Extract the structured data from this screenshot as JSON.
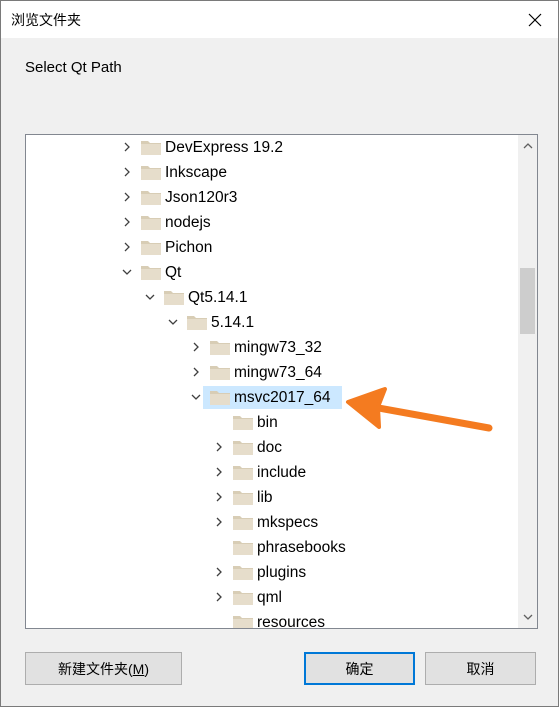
{
  "window": {
    "title": "浏览文件夹",
    "close_icon": "close-icon"
  },
  "prompt": "Select Qt Path",
  "tree": {
    "nodes": [
      {
        "label": "DevExpress 19.2",
        "depth": 0,
        "state": "collapsed"
      },
      {
        "label": "Inkscape",
        "depth": 0,
        "state": "collapsed"
      },
      {
        "label": "Json120r3",
        "depth": 0,
        "state": "collapsed"
      },
      {
        "label": "nodejs",
        "depth": 0,
        "state": "collapsed"
      },
      {
        "label": "Pichon",
        "depth": 0,
        "state": "collapsed"
      },
      {
        "label": "Qt",
        "depth": 0,
        "state": "expanded"
      },
      {
        "label": "Qt5.14.1",
        "depth": 1,
        "state": "expanded"
      },
      {
        "label": "5.14.1",
        "depth": 2,
        "state": "expanded"
      },
      {
        "label": "mingw73_32",
        "depth": 3,
        "state": "collapsed"
      },
      {
        "label": "mingw73_64",
        "depth": 3,
        "state": "collapsed"
      },
      {
        "label": "msvc2017_64",
        "depth": 3,
        "state": "expanded",
        "selected": true
      },
      {
        "label": "bin",
        "depth": 4,
        "state": "none"
      },
      {
        "label": "doc",
        "depth": 4,
        "state": "collapsed"
      },
      {
        "label": "include",
        "depth": 4,
        "state": "collapsed"
      },
      {
        "label": "lib",
        "depth": 4,
        "state": "collapsed"
      },
      {
        "label": "mkspecs",
        "depth": 4,
        "state": "collapsed"
      },
      {
        "label": "phrasebooks",
        "depth": 4,
        "state": "none"
      },
      {
        "label": "plugins",
        "depth": 4,
        "state": "collapsed"
      },
      {
        "label": "qml",
        "depth": 4,
        "state": "collapsed"
      },
      {
        "label": "resources",
        "depth": 4,
        "state": "none"
      }
    ],
    "scroll_position": 0.27
  },
  "buttons": {
    "new_folder": {
      "label": "新建文件夹(",
      "mnemonic": "M",
      "suffix": ")"
    },
    "ok": "确定",
    "cancel": "取消"
  },
  "annotation": {
    "color": "#f47b20",
    "icon": "arrow-annotation"
  },
  "colors": {
    "folder": "#e6ddcb",
    "folder_dark": "#d8cdb5",
    "selection": "#cce8ff"
  }
}
